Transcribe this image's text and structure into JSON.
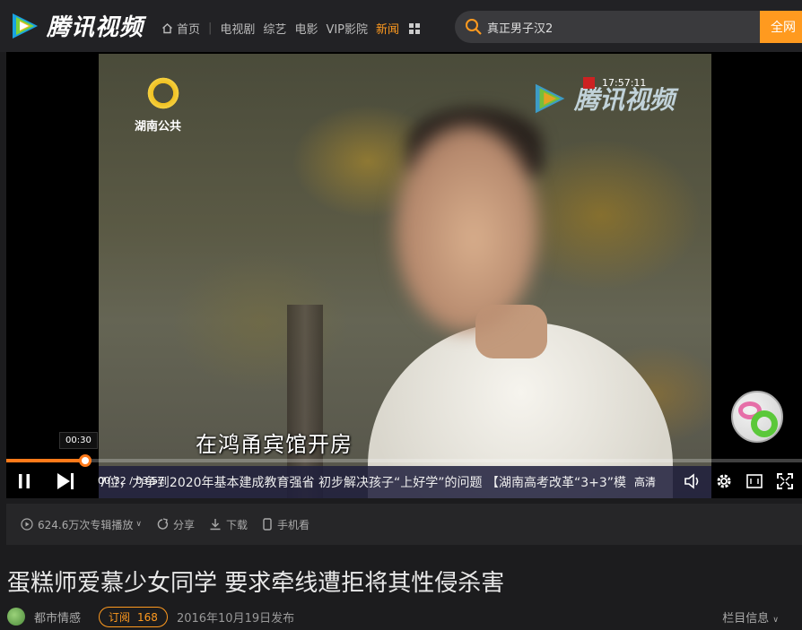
{
  "brand": {
    "name": "腾讯视频",
    "accent": "#ff9a1f"
  },
  "nav": {
    "home": "首页",
    "items": [
      "电视剧",
      "综艺",
      "电影",
      "VIP影院",
      "新闻"
    ],
    "active": "新闻"
  },
  "search": {
    "value": "真正男子汉2",
    "button": "全网"
  },
  "video": {
    "station": "湖南公共",
    "watermark": "腾讯视频",
    "clock": "17:57:11",
    "subtitle": "在鸿甬宾馆开房",
    "ticker": "7位，力争到2020年基本建成教育强省   初步解决孩子“上好学”的问题   【湖南高考改革“3+3”模"
  },
  "player": {
    "tooltip": "00:30",
    "timecode": "00:32 / 03:57",
    "progress_fraction": 0.099,
    "quality": "高清"
  },
  "info": {
    "plays": "624.6万次专辑播放",
    "share": "分享",
    "download": "下载",
    "mobile": "手机看"
  },
  "title": "蛋糕师爱慕少女同学 要求牵线遭拒将其性侵杀害",
  "channel": {
    "name": "都市情感",
    "subscribe": "订阅",
    "subscribers": "168",
    "date": "2016年10月19日发布",
    "column_info": "栏目信息"
  }
}
